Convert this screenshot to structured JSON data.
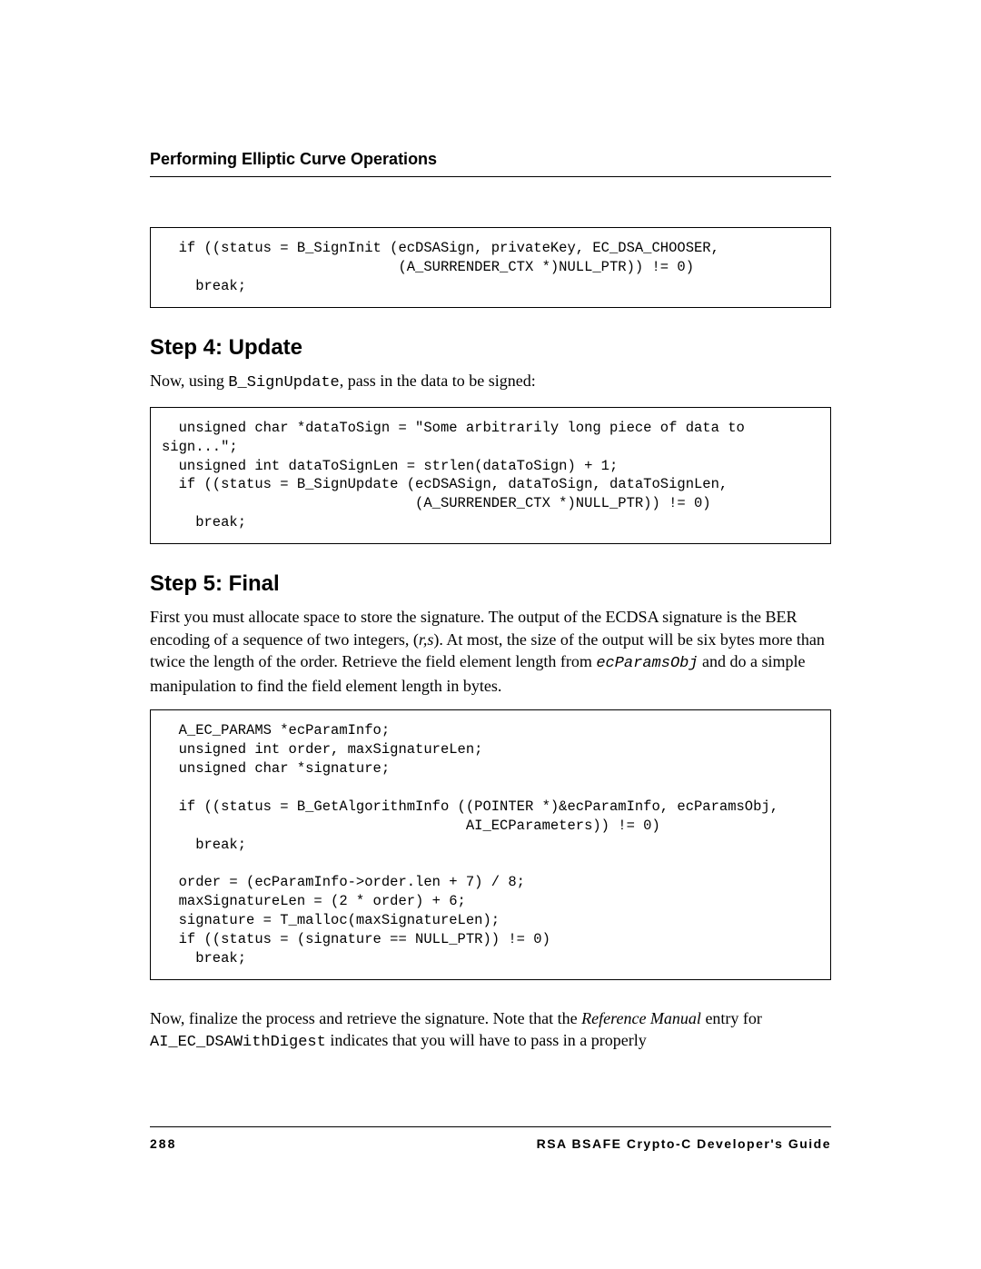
{
  "header": {
    "title": "Performing Elliptic Curve Operations"
  },
  "code1": "  if ((status = B_SignInit (ecDSASign, privateKey, EC_DSA_CHOOSER,\n                            (A_SURRENDER_CTX *)NULL_PTR)) != 0)\n    break;",
  "step4": {
    "heading": "Step 4:  Update",
    "para_prefix": "Now, using ",
    "para_code": "B_SignUpdate",
    "para_suffix": ", pass in the data to be signed:"
  },
  "code2": "  unsigned char *dataToSign = \"Some arbitrarily long piece of data to\nsign...\";\n  unsigned int dataToSignLen = strlen(dataToSign) + 1;\n  if ((status = B_SignUpdate (ecDSASign, dataToSign, dataToSignLen,\n                              (A_SURRENDER_CTX *)NULL_PTR)) != 0)\n    break;",
  "step5": {
    "heading": "Step 5:  Final",
    "p1_a": "First you must allocate space to store the signature. The output of the ECDSA signature is the BER encoding of a sequence of two integers, (",
    "p1_rs": "r,s",
    "p1_b": "). At most, the size of the output will be six bytes more than twice the length of the order. Retrieve the field element length from ",
    "p1_code": "ecParamsObj",
    "p1_c": " and do a simple manipulation to find the field element length in bytes."
  },
  "code3": "  A_EC_PARAMS *ecParamInfo;\n  unsigned int order, maxSignatureLen;\n  unsigned char *signature;\n\n  if ((status = B_GetAlgorithmInfo ((POINTER *)&ecParamInfo, ecParamsObj,\n                                    AI_ECParameters)) != 0)\n    break;\n\n  order = (ecParamInfo->order.len + 7) / 8;\n  maxSignatureLen = (2 * order) + 6;\n  signature = T_malloc(maxSignatureLen);\n  if ((status = (signature == NULL_PTR)) != 0)\n    break;",
  "closing": {
    "a": "Now, finalize the process and retrieve the signature. Note that the ",
    "ref": "Reference Manual",
    "b": " entry for ",
    "code": "AI_EC_DSAWithDigest",
    "c": " indicates that you will have to pass in a properly"
  },
  "footer": {
    "page": "288",
    "title": "RSA BSAFE Crypto-C Developer's Guide"
  }
}
